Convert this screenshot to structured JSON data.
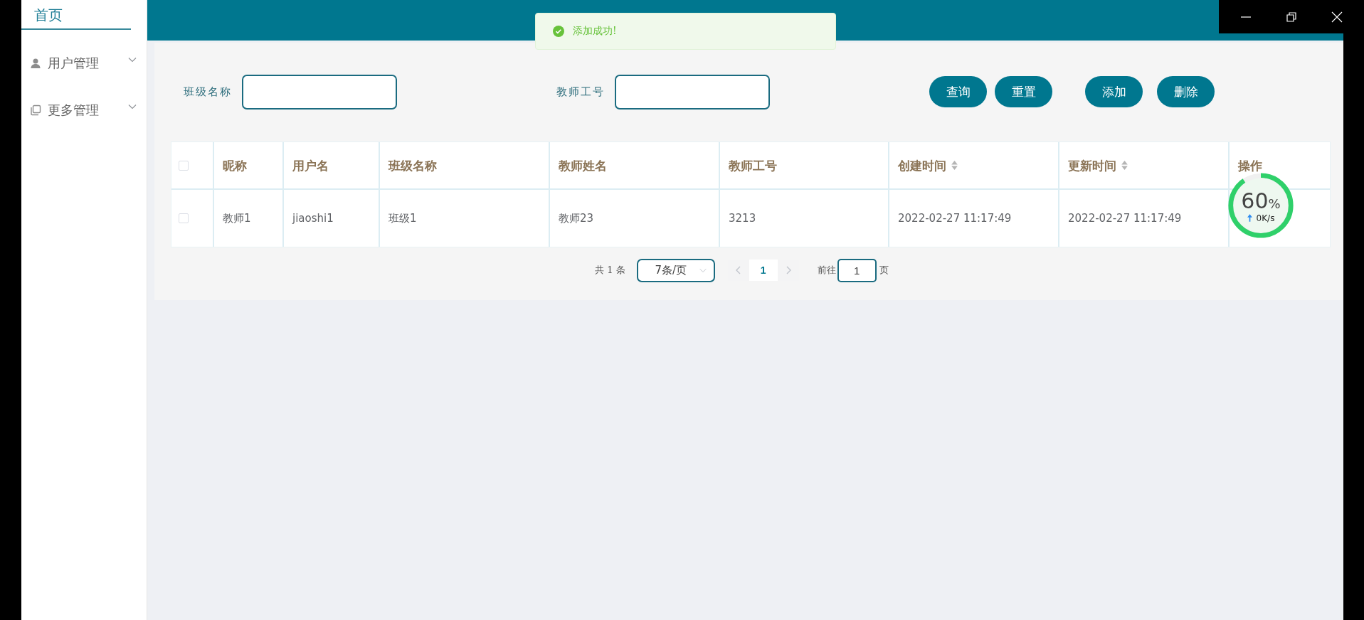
{
  "sidebar": {
    "home": "首页",
    "items": [
      {
        "label": "用户管理",
        "kind": "user",
        "expanded": false
      },
      {
        "label": "更多管理",
        "kind": "copy",
        "expanded": false
      }
    ]
  },
  "toast": {
    "kind": "success",
    "message": "添加成功!"
  },
  "filters": [
    {
      "label": "班级名称"
    },
    {
      "label": "教师工号"
    }
  ],
  "query_buttons": [
    "查询",
    "重置"
  ],
  "action_buttons": [
    "添加",
    "删除"
  ],
  "table": {
    "header_checked": false,
    "columns": [
      {
        "label": "昵称",
        "sortable": false
      },
      {
        "label": "用户名",
        "sortable": false
      },
      {
        "label": "班级名称",
        "sortable": false
      },
      {
        "label": "教师姓名",
        "sortable": false
      },
      {
        "label": "教师工号",
        "sortable": false
      },
      {
        "label": "创建时间",
        "sortable": true
      },
      {
        "label": "更新时间",
        "sortable": true
      },
      {
        "label": "操作",
        "sortable": false
      }
    ],
    "rows": [
      {
        "checked": false,
        "cells": [
          "教师1",
          "jiaoshi1",
          "班级1",
          "教师23",
          "3213",
          "2022-02-27 11:17:49",
          "2022-02-27 11:17:49",
          ""
        ]
      }
    ]
  },
  "pagination": {
    "total": "共 1 条",
    "page_size": "7条/页",
    "pages": [
      {
        "label": "1",
        "selected": true
      }
    ],
    "goto_label": "前往",
    "goto_value": "1",
    "goto_suffix": "页"
  },
  "monitor": {
    "value": "60",
    "unit": "%",
    "speed": "0K/s"
  }
}
